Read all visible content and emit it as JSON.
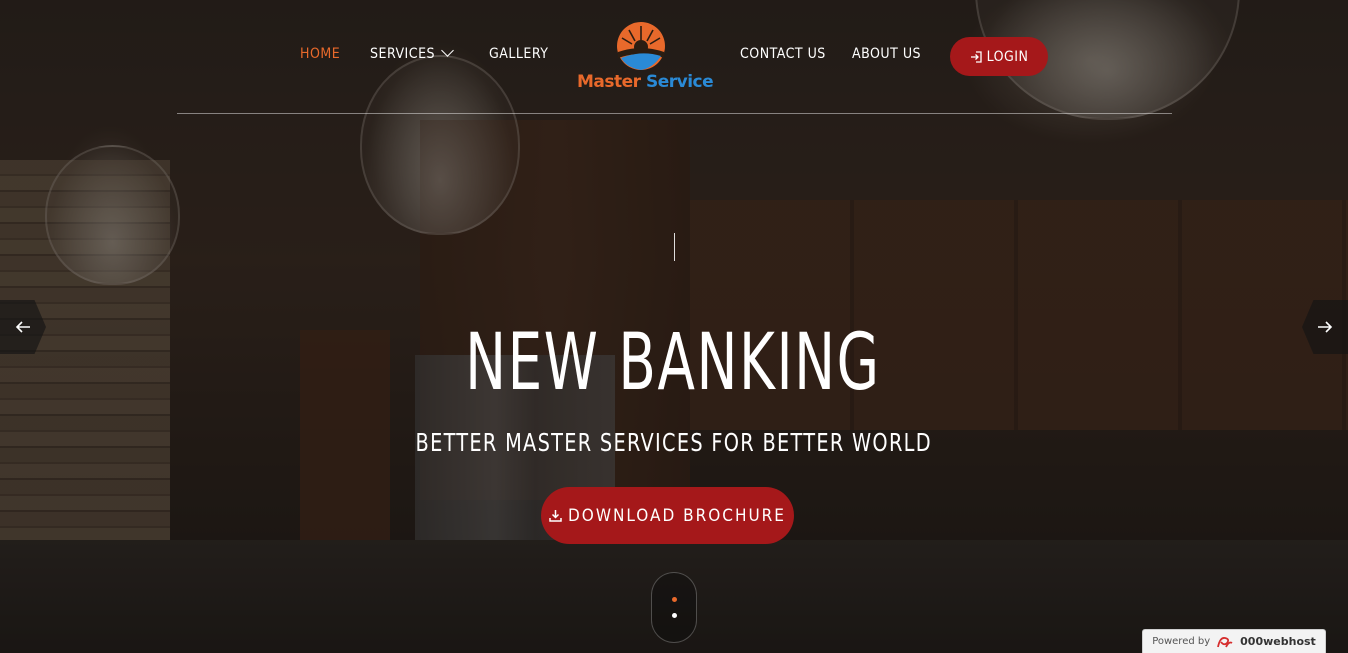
{
  "nav": {
    "items": [
      {
        "label": "HOME",
        "active": true
      },
      {
        "label": "SERVICES",
        "has_dropdown": true
      },
      {
        "label": "GALLERY"
      },
      {
        "label": "CONTACT US"
      },
      {
        "label": "ABOUT US"
      }
    ],
    "login_label": "LOGIN",
    "login_icon": "login-icon"
  },
  "logo": {
    "word1": "Master",
    "word2": "Service",
    "icon": "sun-wave-logo-icon"
  },
  "hero": {
    "headline": "NEW BANKING",
    "subline": "BETTER MASTER SERVICES FOR BETTER WORLD",
    "cta_label": "DOWNLOAD BROCHURE",
    "cta_icon": "download-icon"
  },
  "slider": {
    "prev_icon": "arrow-left-icon",
    "next_icon": "arrow-right-icon",
    "scroll_indicator_dots": 2
  },
  "powered_by": {
    "prefix": "Powered by",
    "brand": "000webhost"
  },
  "colors": {
    "accent_orange": "#e8692b",
    "accent_blue": "#2a8ad6",
    "button_red": "#a5181a"
  }
}
